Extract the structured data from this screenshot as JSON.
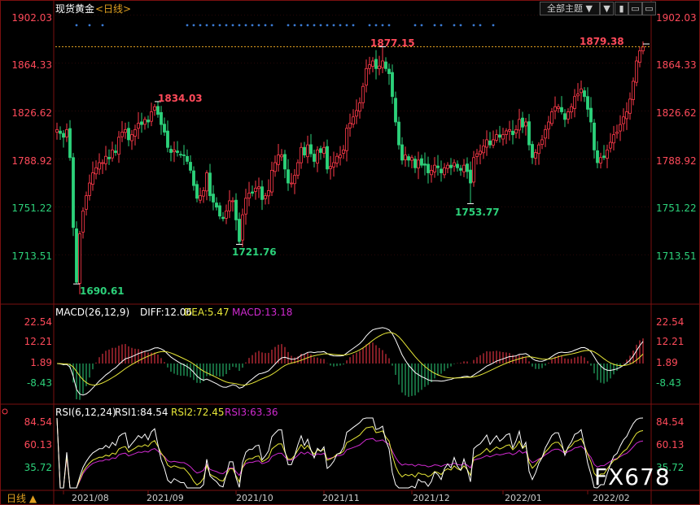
{
  "header": {
    "symbol": "现货黄金",
    "period": "<日线>",
    "theme_label": "全部主题",
    "theme_arrow": "▼"
  },
  "window_buttons": [
    "▼",
    "▮",
    "▭",
    "▭"
  ],
  "watermark": "FX678",
  "chart_data": {
    "type": "candlestick",
    "price_axis": [
      "1902.03",
      "1864.33",
      "1826.62",
      "1788.92",
      "1751.22",
      "1713.51"
    ],
    "ylim": [
      1676.0,
      1905.0
    ],
    "annotations": [
      {
        "label": "1690.61",
        "value": 1690.61,
        "index": 6,
        "kind": "low"
      },
      {
        "label": "1834.03",
        "value": 1834.03,
        "index": 31,
        "kind": "high"
      },
      {
        "label": "1721.76",
        "value": 1721.76,
        "index": 56,
        "kind": "low"
      },
      {
        "label": "1877.15",
        "value": 1877.15,
        "index": 100,
        "kind": "high"
      },
      {
        "label": "1753.77",
        "value": 1753.77,
        "index": 127,
        "kind": "low"
      },
      {
        "label": "1879.38",
        "value": 1879.38,
        "index": 181,
        "kind": "high"
      }
    ],
    "reference_line": 1877.15,
    "x_labels": [
      "2021/08",
      "2021/09",
      "2021/10",
      "2021/11",
      "2021/12",
      "2022/01",
      "2022/02"
    ],
    "x_label_index": [
      2,
      28,
      55,
      82,
      109,
      137,
      163
    ],
    "bar_count": 183,
    "close": [
      1812,
      1809,
      1806,
      1812,
      1790,
      1735,
      1692,
      1730,
      1748,
      1760,
      1770,
      1778,
      1782,
      1786,
      1786,
      1791,
      1789,
      1796,
      1794,
      1806,
      1810,
      1812,
      1804,
      1808,
      1812,
      1817,
      1816,
      1820,
      1818,
      1826,
      1830,
      1824,
      1816,
      1810,
      1798,
      1794,
      1796,
      1794,
      1792,
      1792,
      1787,
      1780,
      1768,
      1758,
      1760,
      1764,
      1778,
      1760,
      1755,
      1751,
      1744,
      1742,
      1748,
      1756,
      1756,
      1741,
      1724,
      1745,
      1758,
      1762,
      1762,
      1766,
      1767,
      1757,
      1760,
      1764,
      1780,
      1786,
      1792,
      1792,
      1781,
      1770,
      1770,
      1776,
      1786,
      1798,
      1792,
      1800,
      1793,
      1787,
      1796,
      1794,
      1798,
      1781,
      1783,
      1786,
      1791,
      1792,
      1796,
      1813,
      1817,
      1822,
      1827,
      1833,
      1846,
      1860,
      1863,
      1866,
      1860,
      1862,
      1866,
      1860,
      1856,
      1838,
      1818,
      1800,
      1788,
      1792,
      1788,
      1790,
      1782,
      1788,
      1784,
      1784,
      1778,
      1780,
      1784,
      1782,
      1778,
      1782,
      1784,
      1782,
      1786,
      1782,
      1780,
      1784,
      1779,
      1770,
      1790,
      1793,
      1795,
      1799,
      1804,
      1800,
      1804,
      1808,
      1806,
      1808,
      1811,
      1812,
      1808,
      1812,
      1820,
      1814,
      1818,
      1800,
      1790,
      1794,
      1800,
      1804,
      1812,
      1818,
      1826,
      1830,
      1830,
      1826,
      1820,
      1826,
      1830,
      1838,
      1840,
      1844,
      1838,
      1828,
      1818,
      1796,
      1786,
      1790,
      1790,
      1796,
      1802,
      1808,
      1810,
      1816,
      1822,
      1826,
      1836,
      1850,
      1866,
      1874,
      1877
    ],
    "macd": {
      "params": "MACD(26,12,9)",
      "diff_label": "DIFF:12.06",
      "dea_label": "DEA:5.47",
      "macd_label": "MACD:13.18",
      "axis": [
        "22.54",
        "12.21",
        "1.89",
        "-8.43"
      ],
      "ylim": [
        -24,
        27
      ]
    },
    "rsi": {
      "params": "RSI(6,12,24)",
      "rsi1_label": "RSI1:84.54",
      "rsi2_label": "RSI2:72.45",
      "rsi3_label": "RSI3:63.36",
      "axis": [
        "84.54",
        "60.13",
        "35.72"
      ],
      "ylim": [
        20,
        92
      ]
    }
  },
  "footer": {
    "period_button": "日线 ▲"
  },
  "colors": {
    "up": "#ff3a4a",
    "down": "#2cd17a",
    "axis_text": "#ff4a5a",
    "diff": "#ffffff",
    "dea": "#e8e838",
    "macd": "#d02ad0",
    "rsi1": "#ffffff",
    "rsi2": "#e8e838",
    "rsi3": "#d02ad0",
    "dots": "#3a7bd5",
    "grid": "#3a0a0a"
  }
}
